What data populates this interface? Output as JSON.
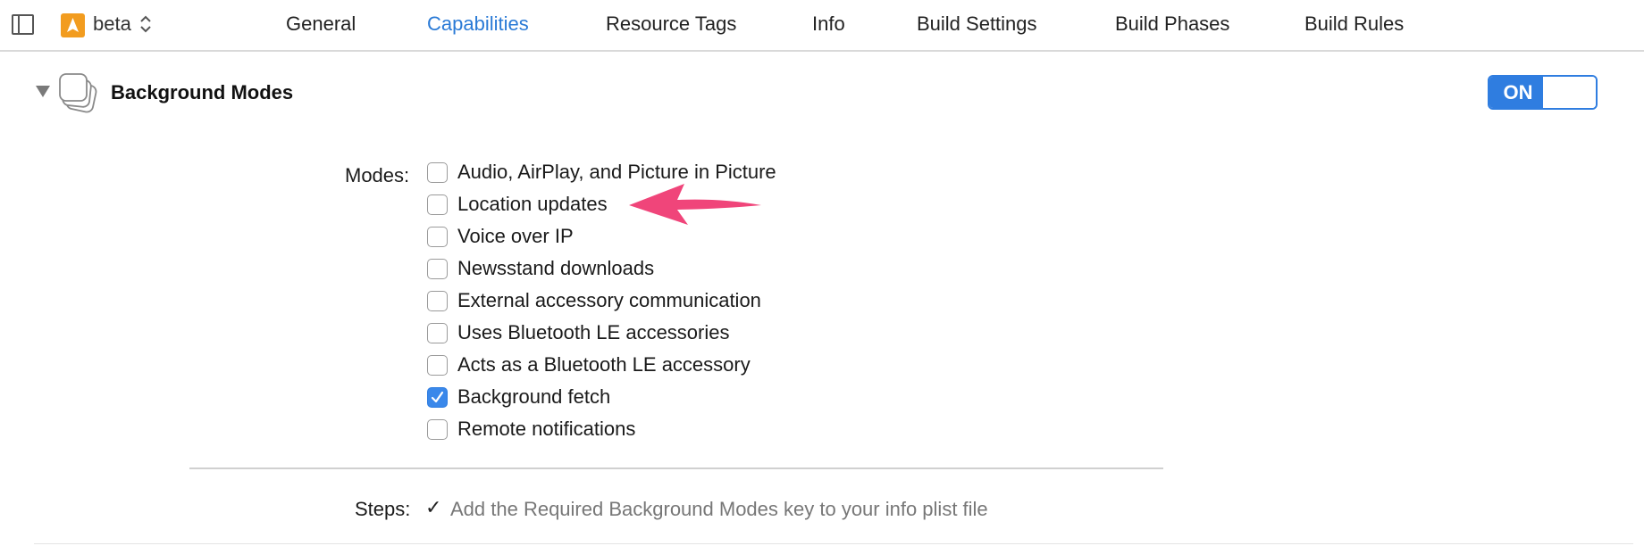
{
  "target": {
    "name": "beta",
    "icon": "app-target-icon"
  },
  "tabs": [
    {
      "label": "General",
      "active": false
    },
    {
      "label": "Capabilities",
      "active": true
    },
    {
      "label": "Resource Tags",
      "active": false
    },
    {
      "label": "Info",
      "active": false
    },
    {
      "label": "Build Settings",
      "active": false
    },
    {
      "label": "Build Phases",
      "active": false
    },
    {
      "label": "Build Rules",
      "active": false
    }
  ],
  "capability": {
    "title": "Background Modes",
    "toggle_label": "ON",
    "toggle_state": true,
    "modes_label": "Modes:",
    "modes": [
      {
        "label": "Audio, AirPlay, and Picture in Picture",
        "checked": false
      },
      {
        "label": "Location updates",
        "checked": false
      },
      {
        "label": "Voice over IP",
        "checked": false
      },
      {
        "label": "Newsstand downloads",
        "checked": false
      },
      {
        "label": "External accessory communication",
        "checked": false
      },
      {
        "label": "Uses Bluetooth LE accessories",
        "checked": false
      },
      {
        "label": "Acts as a Bluetooth LE accessory",
        "checked": false
      },
      {
        "label": "Background fetch",
        "checked": true
      },
      {
        "label": "Remote notifications",
        "checked": false
      }
    ],
    "steps_label": "Steps:",
    "steps": [
      {
        "check": "✓",
        "text": "Add the Required Background Modes key to your info plist file"
      }
    ]
  },
  "colors": {
    "accent": "#2f7de0",
    "active_tab": "#2a7ad6",
    "annotation_arrow": "#f0457a",
    "target_icon": "#f29c1f"
  }
}
